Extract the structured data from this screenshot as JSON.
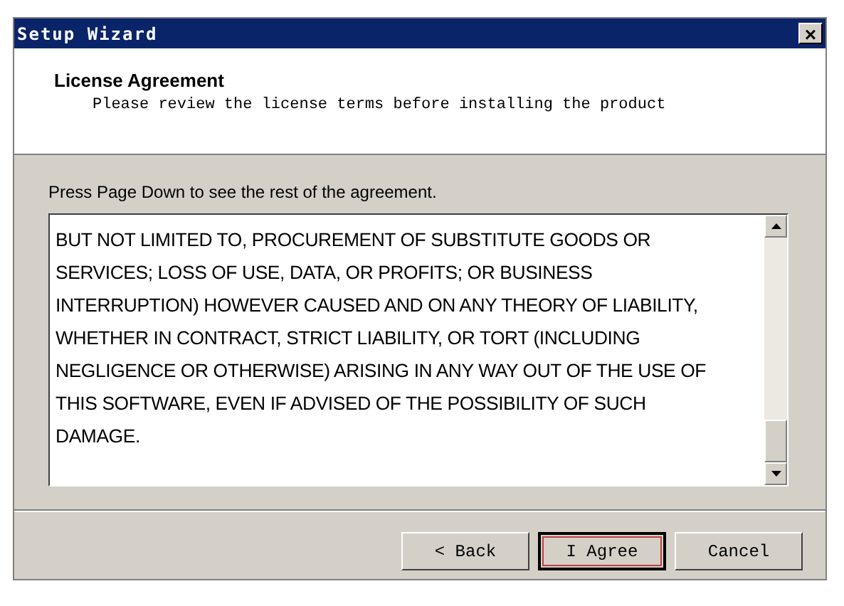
{
  "window": {
    "title": "Setup Wizard",
    "close": "×"
  },
  "header": {
    "title": "License Agreement",
    "subtitle": "Please review the license terms before installing the product"
  },
  "instruction": "Press Page Down to see the rest of the agreement.",
  "license_text": "BUT NOT LIMITED TO, PROCUREMENT OF SUBSTITUTE GOODS OR\nSERVICES; LOSS OF USE, DATA, OR PROFITS; OR BUSINESS\nINTERRUPTION) HOWEVER CAUSED AND ON ANY THEORY OF LIABILITY,\nWHETHER IN CONTRACT, STRICT LIABILITY, OR TORT (INCLUDING\nNEGLIGENCE OR OTHERWISE) ARISING IN ANY WAY OUT OF THE USE OF\nTHIS SOFTWARE, EVEN IF ADVISED OF THE POSSIBILITY OF SUCH\nDAMAGE.",
  "buttons": [
    {
      "label": "< Back",
      "default": false
    },
    {
      "label": "I Agree",
      "default": true
    },
    {
      "label": "Cancel",
      "default": false
    }
  ]
}
